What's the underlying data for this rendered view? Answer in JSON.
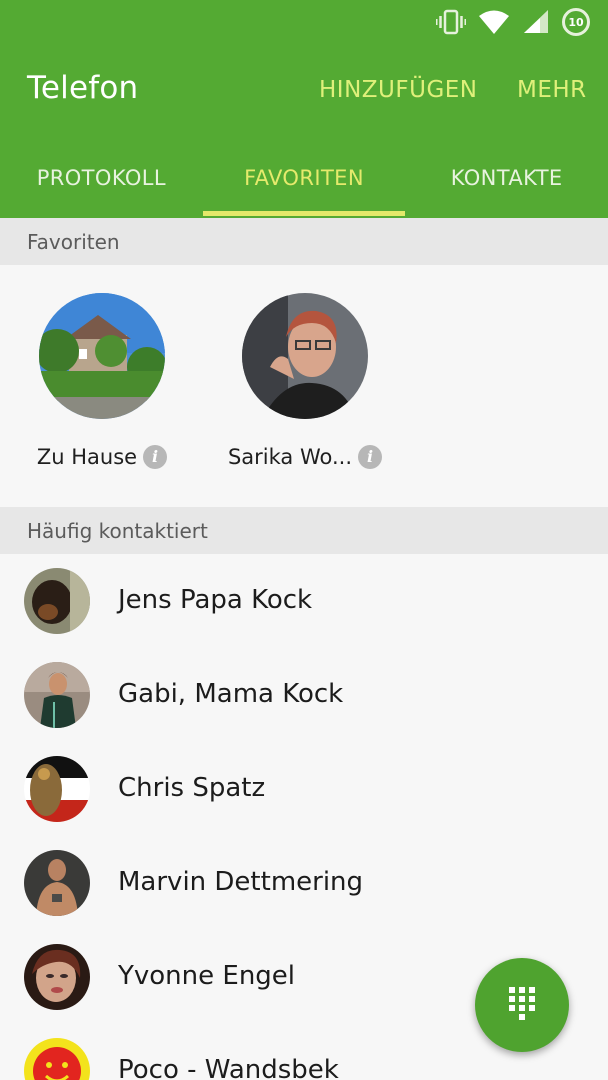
{
  "status_bar": {
    "icons": [
      "vibrate-icon",
      "wifi-icon",
      "cell-signal-icon",
      "battery-icon"
    ],
    "battery_level": "10"
  },
  "app_bar": {
    "title": "Telefon",
    "add_label": "HINZUFÜGEN",
    "more_label": "MEHR"
  },
  "tabs": [
    {
      "label": "PROTOKOLL",
      "active": false
    },
    {
      "label": "FAVORITEN",
      "active": true
    },
    {
      "label": "KONTAKTE",
      "active": false
    }
  ],
  "favorites": {
    "header": "Favoriten",
    "items": [
      {
        "name": "Zu Hause",
        "icon": "info-icon"
      },
      {
        "name": "Sarika Wo...",
        "icon": "info-icon"
      }
    ]
  },
  "frequent": {
    "header": "Häufig kontaktiert",
    "items": [
      {
        "name": "Jens Papa Kock"
      },
      {
        "name": "Gabi, Mama Kock"
      },
      {
        "name": "Chris Spatz"
      },
      {
        "name": "Marvin Dettmering"
      },
      {
        "name": "Yvonne Engel"
      },
      {
        "name": "Poco - Wandsbek"
      }
    ]
  },
  "fab": {
    "icon": "dialpad-icon"
  },
  "colors": {
    "app_bar": "#54aa33",
    "active_tab": "#e5ea6c",
    "action_text": "#dff07a",
    "fab": "#4fa32f"
  }
}
